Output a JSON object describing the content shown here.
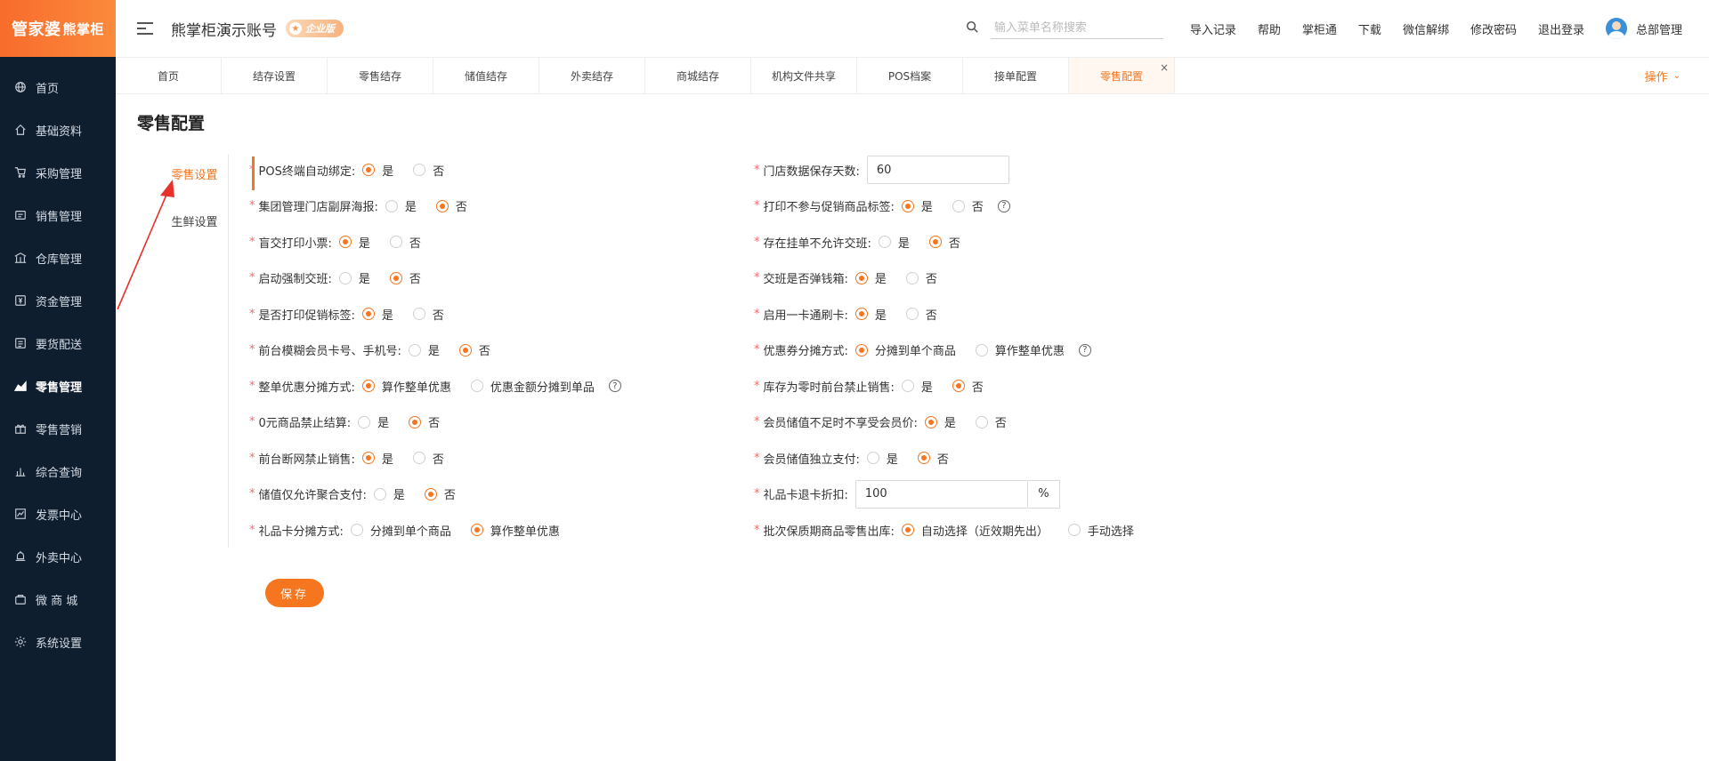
{
  "app": {
    "logo_main": "管家婆",
    "logo_sub": "熊掌柜",
    "account_name": "熊掌柜演示账号",
    "edition_badge": "企业版"
  },
  "sidebar": {
    "items": [
      {
        "label": "首页",
        "icon": "globe-icon"
      },
      {
        "label": "基础资料",
        "icon": "home-icon"
      },
      {
        "label": "采购管理",
        "icon": "cart-icon"
      },
      {
        "label": "销售管理",
        "icon": "sales-icon"
      },
      {
        "label": "仓库管理",
        "icon": "warehouse-icon"
      },
      {
        "label": "资金管理",
        "icon": "money-icon"
      },
      {
        "label": "要货配送",
        "icon": "list-icon"
      },
      {
        "label": "零售管理",
        "icon": "chart-icon"
      },
      {
        "label": "零售营销",
        "icon": "gift-icon"
      },
      {
        "label": "综合查询",
        "icon": "bar-chart-icon"
      },
      {
        "label": "发票中心",
        "icon": "trend-icon"
      },
      {
        "label": "外卖中心",
        "icon": "bell-icon"
      },
      {
        "label": "微 商 城",
        "icon": "bag-icon"
      },
      {
        "label": "系统设置",
        "icon": "gear-icon"
      }
    ],
    "active_index": 7
  },
  "header": {
    "search_placeholder": "输入菜单名称搜索",
    "links": [
      "导入记录",
      "帮助",
      "掌柜通",
      "下载",
      "微信解绑",
      "修改密码",
      "退出登录"
    ],
    "user_name": "总部管理"
  },
  "tabs": {
    "items": [
      "首页",
      "结存设置",
      "零售结存",
      "储值结存",
      "外卖结存",
      "商城结存",
      "机构文件共享",
      "POS档案",
      "接单配置",
      "零售配置"
    ],
    "active_index": 9,
    "close_glyph": "×",
    "ops_label": "操作",
    "ops_chevron": "⌄"
  },
  "page": {
    "title": "零售配置",
    "subnav": [
      "零售设置",
      "生鲜设置"
    ],
    "subnav_active": 0,
    "save_label": "保存"
  },
  "settings_left": [
    {
      "label": "POS终端自动绑定:",
      "options": [
        "是",
        "否"
      ],
      "selected": 0,
      "help": false
    },
    {
      "label": "集团管理门店副屏海报:",
      "options": [
        "是",
        "否"
      ],
      "selected": 1,
      "help": false
    },
    {
      "label": "盲交打印小票:",
      "options": [
        "是",
        "否"
      ],
      "selected": 0,
      "help": false
    },
    {
      "label": "启动强制交班:",
      "options": [
        "是",
        "否"
      ],
      "selected": 1,
      "help": false
    },
    {
      "label": "是否打印促销标签:",
      "options": [
        "是",
        "否"
      ],
      "selected": 0,
      "help": false
    },
    {
      "label": "前台模糊会员卡号、手机号:",
      "options": [
        "是",
        "否"
      ],
      "selected": 1,
      "help": false
    },
    {
      "label": "整单优惠分摊方式:",
      "options": [
        "算作整单优惠",
        "优惠金额分摊到单品"
      ],
      "selected": 0,
      "help": true
    },
    {
      "label": "0元商品禁止结算:",
      "options": [
        "是",
        "否"
      ],
      "selected": 1,
      "help": false
    },
    {
      "label": "前台断网禁止销售:",
      "options": [
        "是",
        "否"
      ],
      "selected": 0,
      "help": false
    },
    {
      "label": "储值仅允许聚合支付:",
      "options": [
        "是",
        "否"
      ],
      "selected": 1,
      "help": false
    },
    {
      "label": "礼品卡分摊方式:",
      "options": [
        "分摊到单个商品",
        "算作整单优惠"
      ],
      "selected": 1,
      "help": false
    }
  ],
  "settings_right": [
    {
      "label": "门店数据保存天数:",
      "input_value": "60"
    },
    {
      "label": "打印不参与促销商品标签:",
      "options": [
        "是",
        "否"
      ],
      "selected": 0,
      "help": true
    },
    {
      "label": "存在挂单不允许交班:",
      "options": [
        "是",
        "否"
      ],
      "selected": 1,
      "help": false
    },
    {
      "label": "交班是否弹钱箱:",
      "options": [
        "是",
        "否"
      ],
      "selected": 0,
      "help": false
    },
    {
      "label": "启用一卡通刷卡:",
      "options": [
        "是",
        "否"
      ],
      "selected": 0,
      "help": false
    },
    {
      "label": "优惠券分摊方式:",
      "options": [
        "分摊到单个商品",
        "算作整单优惠"
      ],
      "selected": 0,
      "help": true
    },
    {
      "label": "库存为零时前台禁止销售:",
      "options": [
        "是",
        "否"
      ],
      "selected": 1,
      "help": false
    },
    {
      "label": "会员储值不足时不享受会员价:",
      "options": [
        "是",
        "否"
      ],
      "selected": 0,
      "help": false
    },
    {
      "label": "会员储值独立支付:",
      "options": [
        "是",
        "否"
      ],
      "selected": 1,
      "help": false
    },
    {
      "label": "礼品卡退卡折扣:",
      "input_value": "100",
      "suffix": "%"
    },
    {
      "label": "批次保质期商品零售出库:",
      "options": [
        "自动选择（近效期先出）",
        "手动选择"
      ],
      "selected": 0,
      "help": false
    }
  ],
  "colors": {
    "accent": "#f5761f",
    "sidebar_bg": "#0f1e2f",
    "required": "#f56c6c",
    "annotation_arrow": "#e8302c"
  }
}
